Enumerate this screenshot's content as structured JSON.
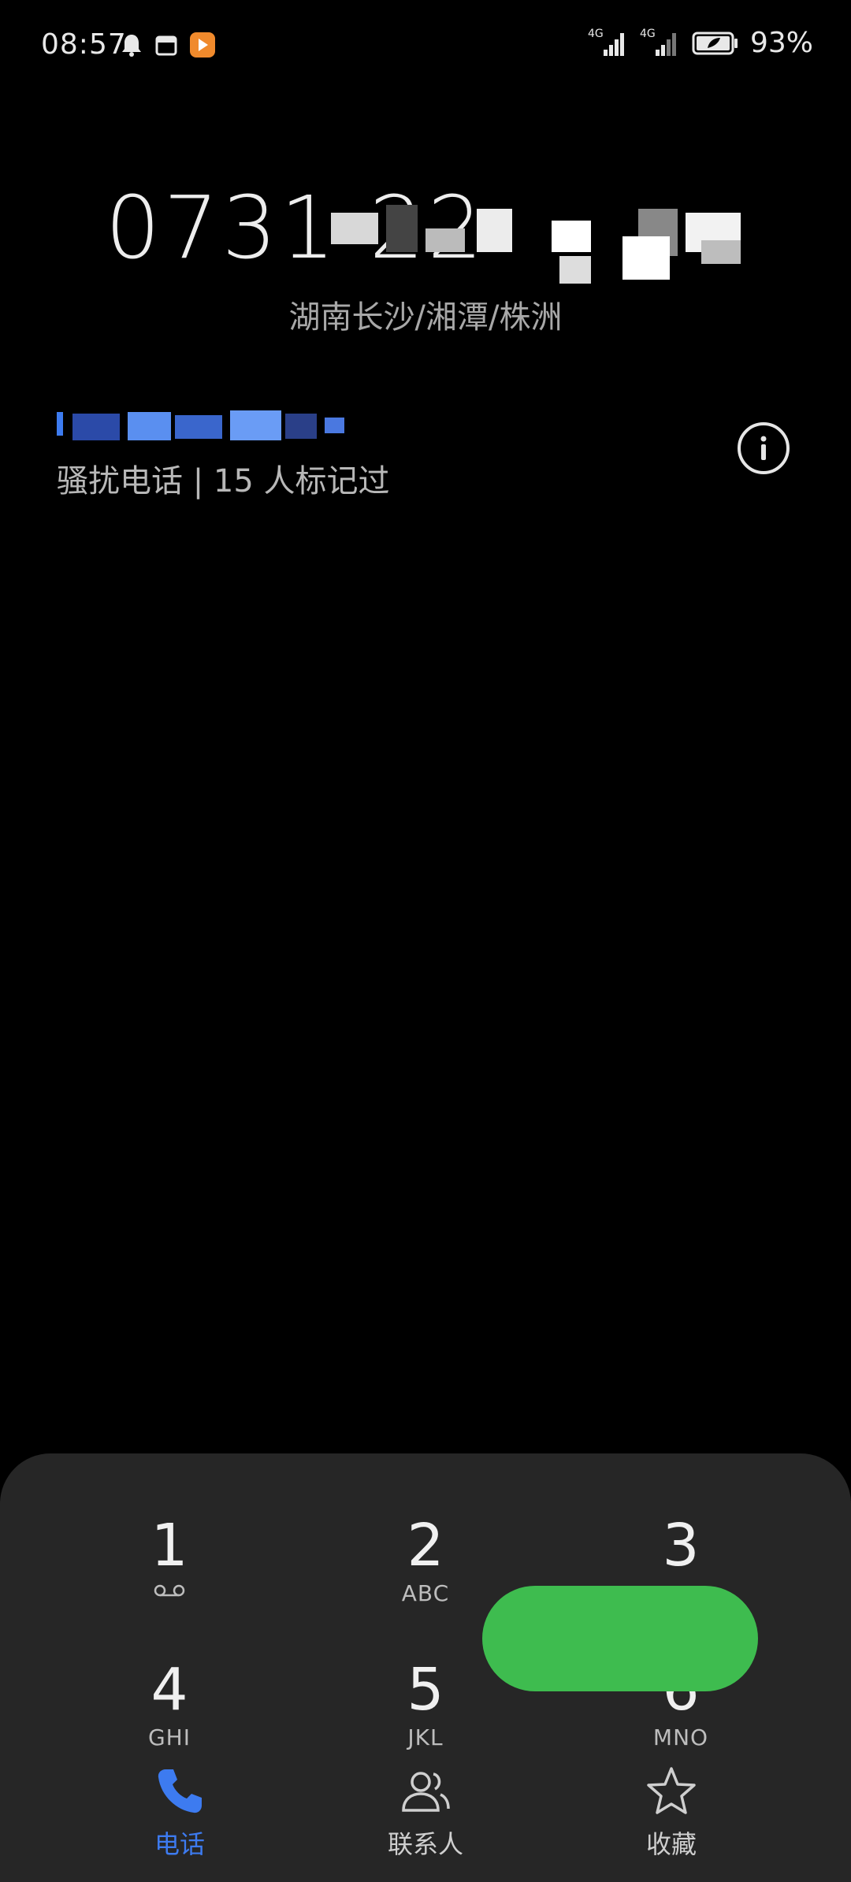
{
  "status": {
    "time": "08:57",
    "network_1": "4G",
    "network_2": "4G",
    "battery": "93%"
  },
  "call": {
    "number": "0731 22",
    "location": "湖南长沙/湘潭/株洲",
    "tag_label": "骚扰电话 | 15 人标记过"
  },
  "dialpad": {
    "keys": [
      {
        "digit": "1",
        "letters": ""
      },
      {
        "digit": "2",
        "letters": "ABC"
      },
      {
        "digit": "3",
        "letters": ""
      },
      {
        "digit": "4",
        "letters": "GHI"
      },
      {
        "digit": "5",
        "letters": "JKL"
      },
      {
        "digit": "6",
        "letters": "MNO"
      }
    ]
  },
  "tabs": [
    {
      "label": "电话"
    },
    {
      "label": "联系人"
    },
    {
      "label": "收藏"
    }
  ],
  "colors": {
    "accent": "#3d7bf0",
    "call_green": "#3ebc4f",
    "panel_bg": "#262626"
  }
}
